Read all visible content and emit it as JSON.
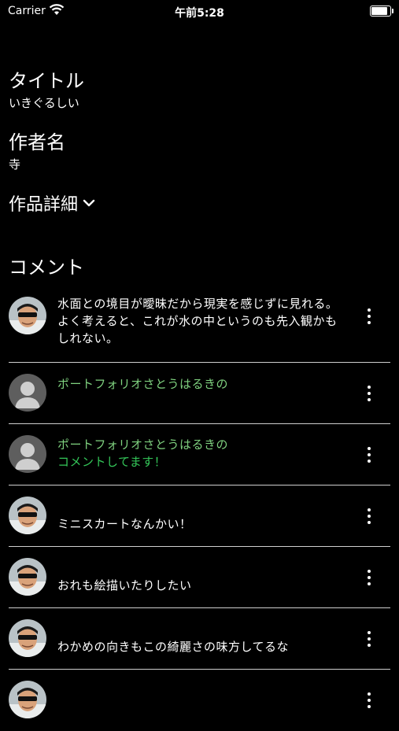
{
  "status": {
    "carrier": "Carrier",
    "time": "午前5:28"
  },
  "work": {
    "title_label": "タイトル",
    "title_value": "いきぐるしい",
    "author_label": "作者名",
    "author_value": "寺",
    "details_label": "作品詳細"
  },
  "comments_heading": "コメント",
  "comments": [
    {
      "avatar": "person-photo",
      "text": "水面との境目が曖昧だから現実を感じずに見れる。よく考えると、これが水の中というのも先入観かもしれない。"
    },
    {
      "avatar": "default-person",
      "text": "ポートフォリオさとうはるきの"
    },
    {
      "avatar": "default-person",
      "text": "ポートフォリオさとうはるきの",
      "text2": "コメントしてます！"
    },
    {
      "avatar": "person-photo",
      "text": "ミニスカートなんかい！"
    },
    {
      "avatar": "person-photo",
      "text": "おれも絵描いたりしたい"
    },
    {
      "avatar": "person-photo",
      "text": "わかめの向きもこの綺麗さの味方してるな"
    },
    {
      "avatar": "person-photo",
      "text": ""
    }
  ],
  "colors": {
    "background": "#000000",
    "text": "#ffffff",
    "accent_green": "#34c759",
    "muted_green": "#7fd17f"
  }
}
